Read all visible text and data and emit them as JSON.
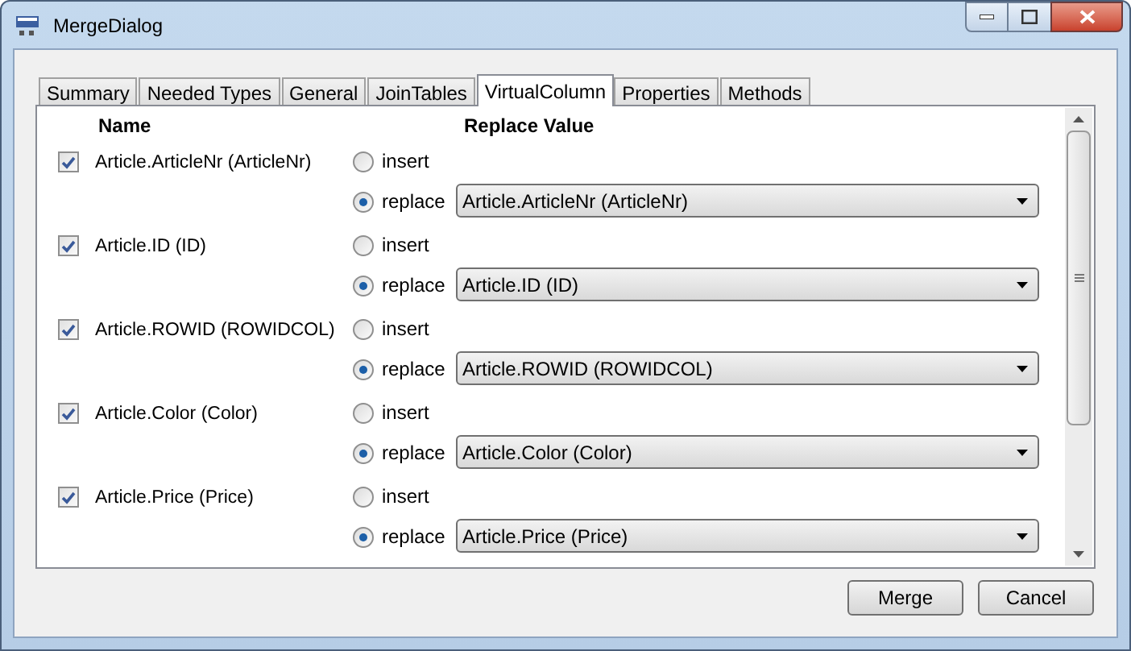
{
  "window": {
    "title": "MergeDialog"
  },
  "tabs": [
    {
      "label": "Summary",
      "selected": false
    },
    {
      "label": "Needed Types",
      "selected": false
    },
    {
      "label": "General",
      "selected": false
    },
    {
      "label": "JoinTables",
      "selected": false
    },
    {
      "label": "VirtualColumn",
      "selected": true
    },
    {
      "label": "Properties",
      "selected": false
    },
    {
      "label": "Methods",
      "selected": false
    }
  ],
  "columns": {
    "name": "Name",
    "replace_value": "Replace Value"
  },
  "rows": [
    {
      "name": "Article.ArticleNr (ArticleNr)",
      "checked": true,
      "options": [
        {
          "label": "insert",
          "selected": false
        },
        {
          "label": "replace",
          "selected": true
        }
      ],
      "value": "Article.ArticleNr (ArticleNr)"
    },
    {
      "name": "Article.ID (ID)",
      "checked": true,
      "options": [
        {
          "label": "insert",
          "selected": false
        },
        {
          "label": "replace",
          "selected": true
        }
      ],
      "value": "Article.ID (ID)"
    },
    {
      "name": "Article.ROWID (ROWIDCOL)",
      "checked": true,
      "options": [
        {
          "label": "insert",
          "selected": false
        },
        {
          "label": "replace",
          "selected": true
        }
      ],
      "value": "Article.ROWID (ROWIDCOL)"
    },
    {
      "name": "Article.Color (Color)",
      "checked": true,
      "options": [
        {
          "label": "insert",
          "selected": false
        },
        {
          "label": "replace",
          "selected": true
        }
      ],
      "value": "Article.Color (Color)"
    },
    {
      "name": "Article.Price (Price)",
      "checked": true,
      "options": [
        {
          "label": "insert",
          "selected": false
        },
        {
          "label": "replace",
          "selected": true
        }
      ],
      "value": "Article.Price (Price)"
    }
  ],
  "buttons": [
    "Merge",
    "Cancel"
  ]
}
